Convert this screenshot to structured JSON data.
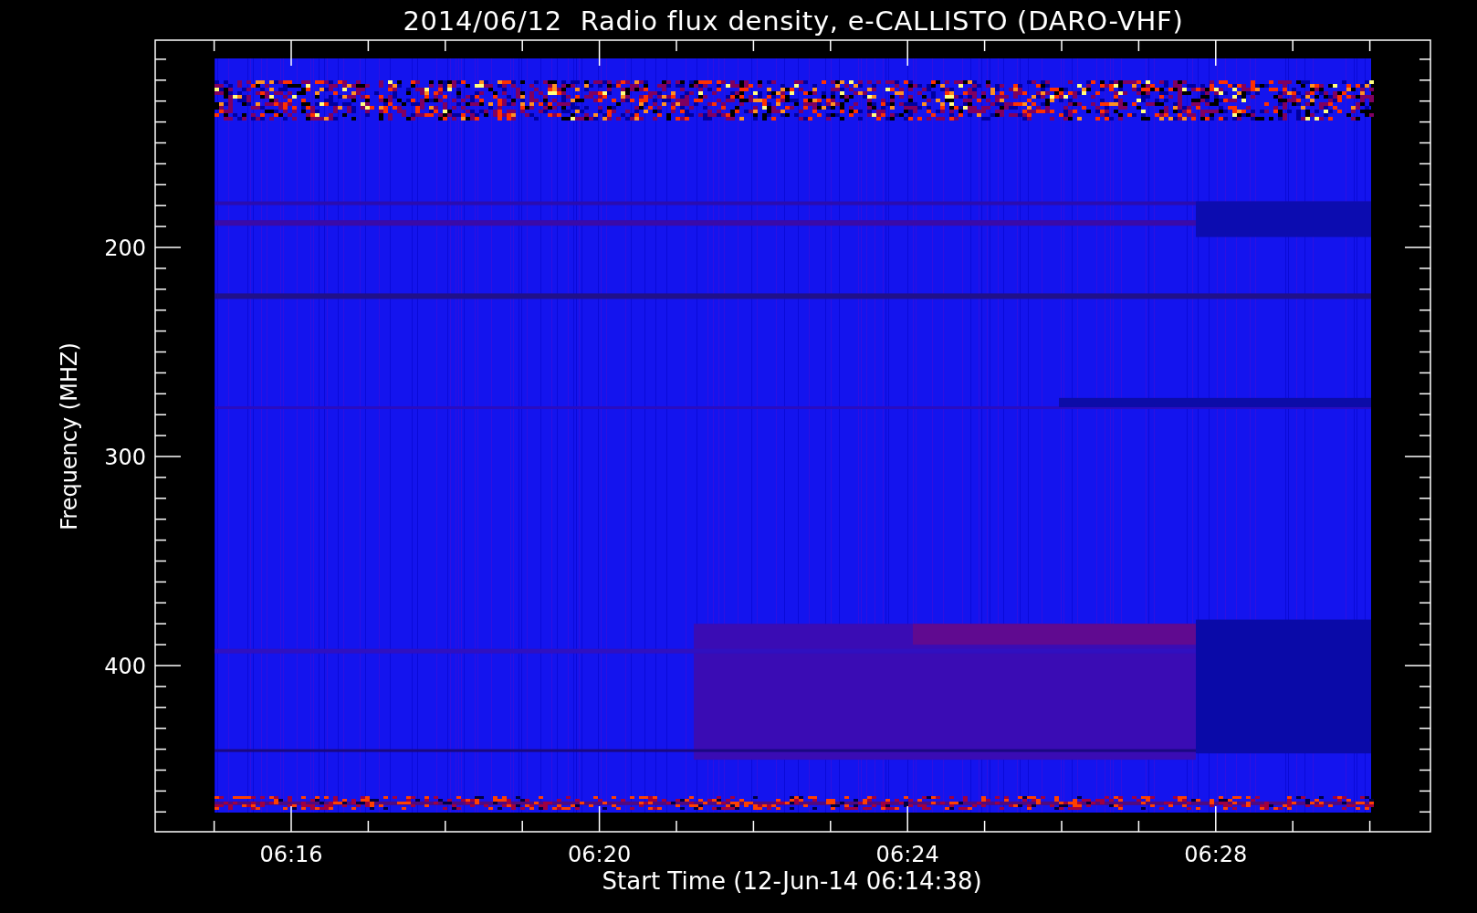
{
  "title": "2014/06/12  Radio flux density, e-CALLISTO (DARO-VHF)",
  "y_axis": {
    "label": "Frequency (MHZ)",
    "ticks": [
      "200",
      "300",
      "400"
    ]
  },
  "x_axis": {
    "label": "Start Time (12-Jun-14 06:14:38)",
    "ticks": [
      "06:16",
      "06:20",
      "06:24",
      "06:28"
    ]
  }
}
